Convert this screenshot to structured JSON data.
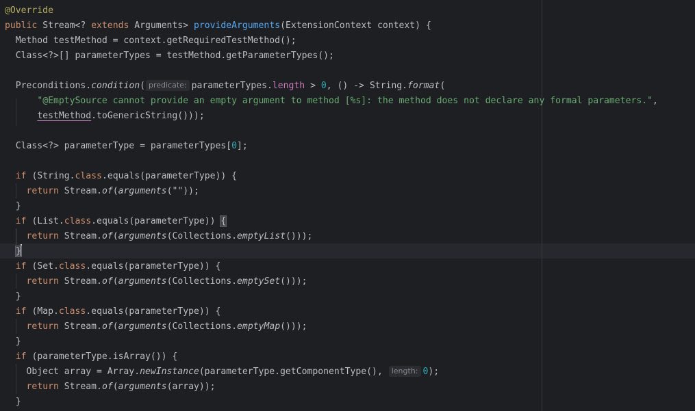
{
  "code": {
    "annotation": "@Override",
    "kw_public": "public",
    "sig_stream": " Stream<? ",
    "kw_extends": "extends",
    "sig_args": " Arguments> ",
    "method_name": "provideArguments",
    "sig_params": "(ExtensionContext context) {",
    "l3": "  Method testMethod = context.getRequiredTestMethod();",
    "l4": "  Class<?>[] parameterTypes = testMethod.getParameterTypes();",
    "l6_a": "  Preconditions.",
    "l6_condition": "condition",
    "l6_b": "(",
    "hint_predicate": "predicate:",
    "l6_c": "parameterTypes.",
    "l6_length": "length",
    "l6_d": " > ",
    "l6_zero": "0",
    "l6_e": ", () -> String.",
    "l6_format": "format",
    "l6_f": "(",
    "l7_indent": "      ",
    "l7_string": "\"@EmptySource cannot provide an empty argument to method [%s]: the method does not declare any formal parameters.\"",
    "l7_comma": ",",
    "l8_indent": "      ",
    "l8_testmethod": "testMethod",
    "l8_rest": ".toGenericString()));",
    "l10_a": "  Class<?> parameterType = parameterTypes[",
    "l10_zero": "0",
    "l10_b": "];",
    "kw_if": "if",
    "kw_class": "class",
    "kw_return": "return",
    "l12_a": " (String.",
    "l12_b": ".equals(parameterType)) {",
    "ret_a": " Stream.",
    "of": "of",
    "ret_b": "(",
    "arguments": "arguments",
    "l13_c": "(\"\"));",
    "close_brace": "}",
    "l15_a": " (List.",
    "l15_b": ".equals(parameterType)) ",
    "open_brace": "{",
    "l16_c": "(Collections.",
    "emptyList": "emptyList",
    "l16_d": "()));",
    "l18_a": " (Set.",
    "l18_b": ".equals(parameterType)) {",
    "emptySet": "emptySet",
    "l21_a": " (Map.",
    "l21_b": ".equals(parameterType)) {",
    "emptyMap": "emptyMap",
    "l24_a": " (parameterType.isArray()) {",
    "l25_a": "    Object array = Array.",
    "newInstance": "newInstance",
    "l25_b": "(parameterType.getComponentType(), ",
    "hint_length": "length:",
    "l25_zero": "0",
    "l25_c": ");",
    "l26_c": "(array));"
  }
}
